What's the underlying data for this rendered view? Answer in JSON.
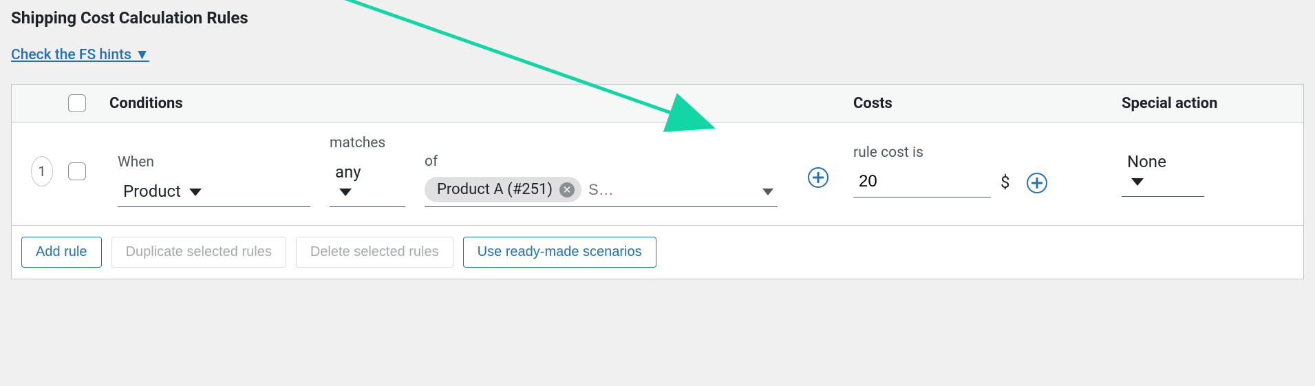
{
  "title": "Shipping Cost Calculation Rules",
  "hints_link": "Check the FS hints ▼",
  "table": {
    "head": {
      "conditions": "Conditions",
      "costs": "Costs",
      "special": "Special action"
    },
    "row1": {
      "num": "1",
      "labels": {
        "when": "When",
        "matches": "matches",
        "of": "of",
        "rule_cost": "rule cost is"
      },
      "values": {
        "when_select": "Product",
        "matches_select": "any",
        "chip_label": "Product A (#251)",
        "search_placeholder": "S…",
        "cost_value": "20",
        "currency": "$",
        "special_select": "None"
      }
    }
  },
  "footer": {
    "add": "Add rule",
    "duplicate": "Duplicate selected rules",
    "delete": "Delete selected rules",
    "scenarios": "Use ready-made scenarios"
  }
}
